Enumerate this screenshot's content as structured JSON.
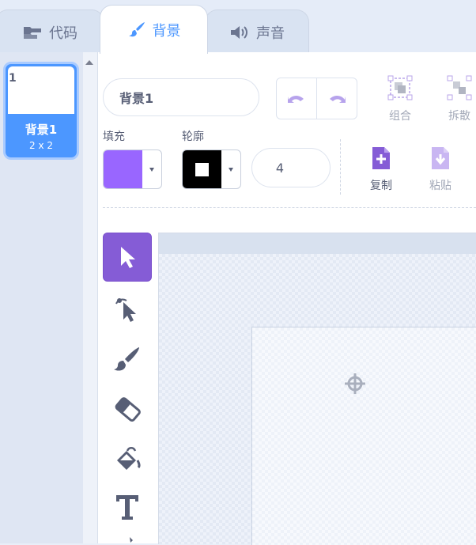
{
  "tabs": [
    {
      "label": "代码",
      "icon": "code-blocks-icon"
    },
    {
      "label": "背景",
      "icon": "paintbrush-icon",
      "active": true
    },
    {
      "label": "声音",
      "icon": "speaker-icon"
    }
  ],
  "backdrops": [
    {
      "number": "1",
      "name": "背景1",
      "size": "2 x 2",
      "selected": true
    }
  ],
  "editor": {
    "costume_name": "背景1",
    "group_label": "组合",
    "ungroup_label": "拆散",
    "copy_label": "复制",
    "paste_label": "粘贴",
    "fill_label": "填充",
    "outline_label": "轮廓",
    "stroke_width": "4"
  },
  "colors": {
    "fill": "#9966ff",
    "outline": "#000000",
    "accent": "#4c97ff",
    "tool_selected": "#855cd6"
  },
  "tools": [
    {
      "name": "select-tool",
      "icon": "arrow-cursor-icon",
      "selected": true
    },
    {
      "name": "reshape-tool",
      "icon": "reshape-cursor-icon"
    },
    {
      "name": "brush-tool",
      "icon": "brush-icon"
    },
    {
      "name": "eraser-tool",
      "icon": "eraser-icon"
    },
    {
      "name": "fill-tool",
      "icon": "paint-bucket-icon"
    },
    {
      "name": "text-tool",
      "icon": "text-t-icon"
    }
  ]
}
